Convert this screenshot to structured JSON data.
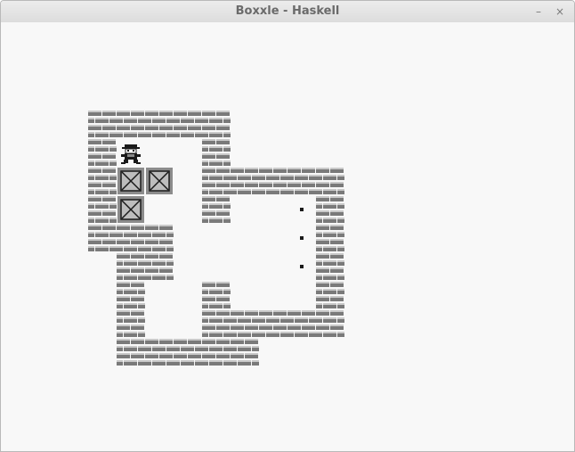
{
  "window": {
    "title": "Boxxle - Haskell",
    "minimize_glyph": "–",
    "close_glyph": "×"
  },
  "level": {
    "legend": {
      "#": "wall",
      "@": "player",
      "$": "crate",
      ".": "goal",
      " ": "floor"
    },
    "rows": [
      "#####    ",
      "#@  #    ",
      "#$$ #####",
      "#$  #  .#",
      "###    .#",
      " ##    .#",
      " #  #   #",
      " #  #####",
      " #####   "
    ]
  },
  "colors": {
    "window_bg": "#f8f8f8",
    "brick_dark": "#7a7a7a",
    "brick_light": "#c9c9c9",
    "crate_fill": "#8c8c8c",
    "crate_inner": "#bdbdbd",
    "ink": "#1a1a1a"
  },
  "icons": {
    "wall": "brick-wall-icon",
    "player": "warehouse-keeper-icon",
    "crate": "crate-icon",
    "goal": "goal-dot-icon"
  }
}
